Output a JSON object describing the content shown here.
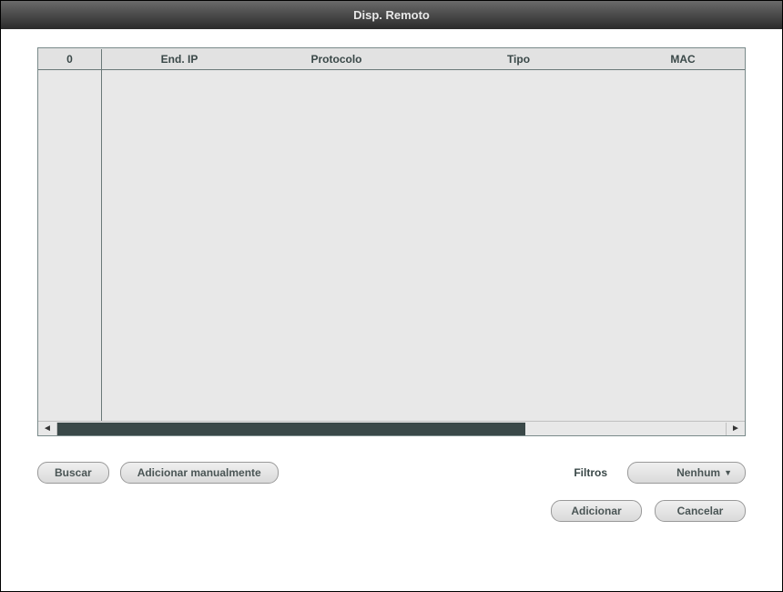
{
  "window": {
    "title": "Disp. Remoto"
  },
  "table": {
    "headers": {
      "count": "0",
      "ip": "End. IP",
      "protocol": "Protocolo",
      "type": "Tipo",
      "mac": "MAC"
    },
    "rows": []
  },
  "buttons": {
    "search": "Buscar",
    "add_manual": "Adicionar manualmente",
    "add": "Adicionar",
    "cancel": "Cancelar"
  },
  "filter": {
    "label": "Filtros",
    "selected": "Nenhum"
  }
}
